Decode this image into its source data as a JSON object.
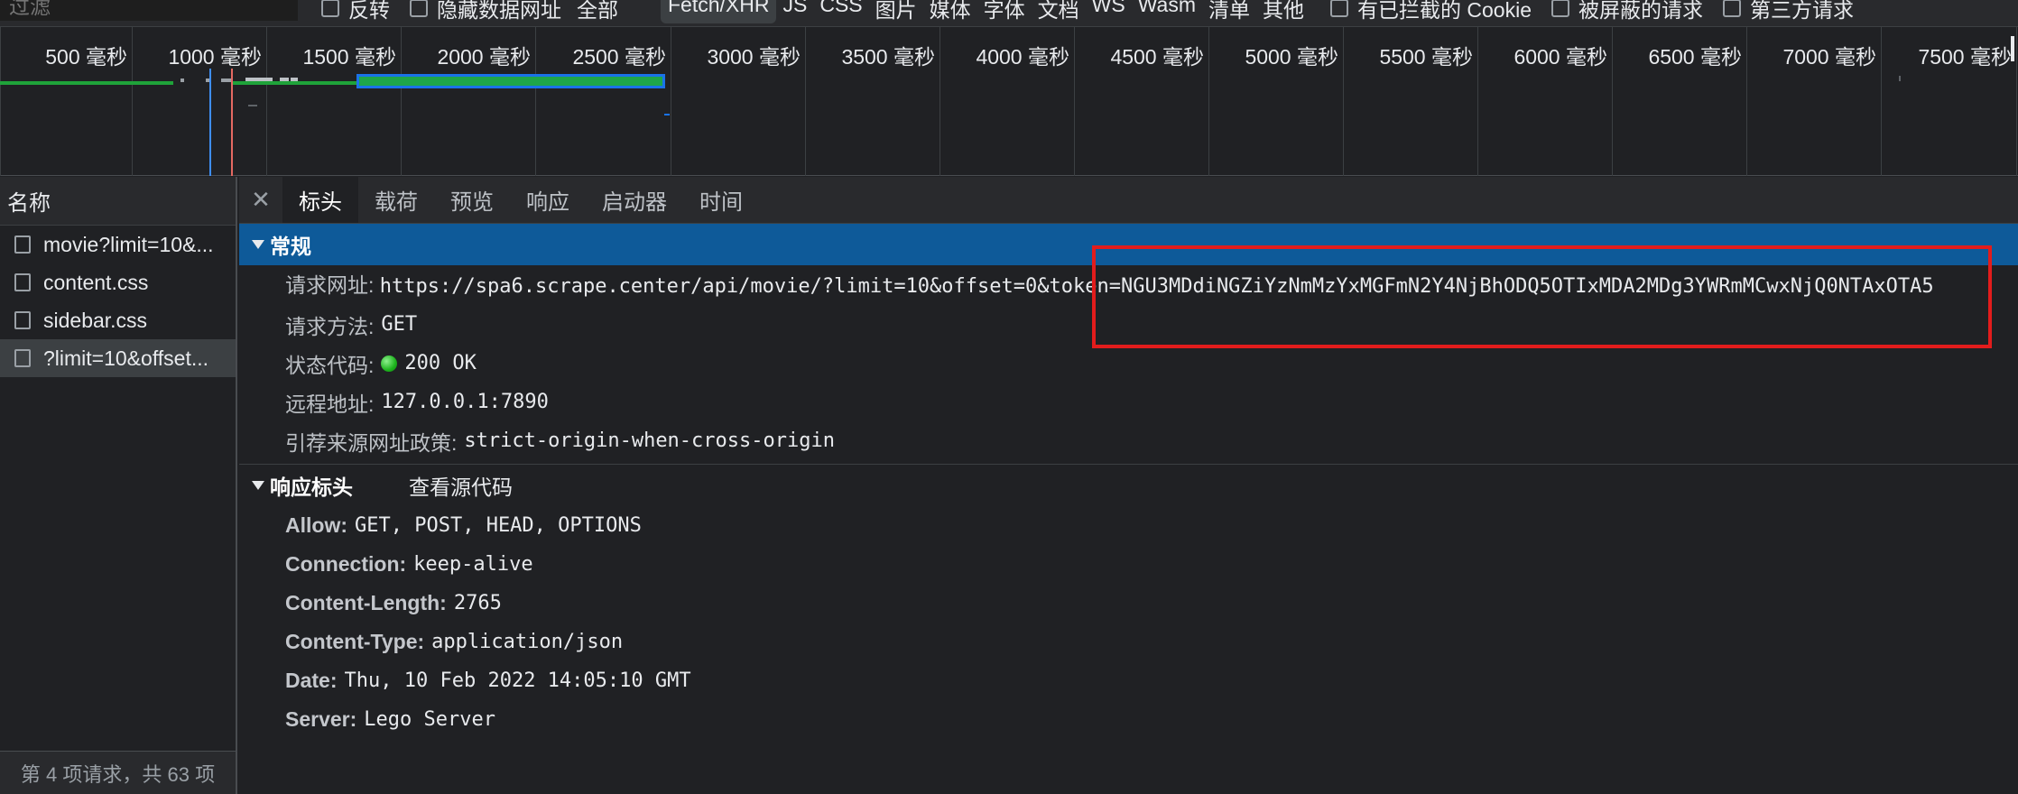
{
  "filter": {
    "placeholder": "过滤",
    "invert_label": "反转",
    "hide_data_urls_label": "隐藏数据网址",
    "types": [
      "全部",
      "Fetch/XHR",
      "JS",
      "CSS",
      "图片",
      "媒体",
      "字体",
      "文档",
      "WS",
      "Wasm",
      "清单",
      "其他"
    ],
    "active_type": "Fetch/XHR",
    "blocked_cookies_label": "有已拦截的 Cookie",
    "blocked_requests_label": "被屏蔽的请求",
    "third_party_label": "第三方请求"
  },
  "timeline": {
    "ticks": [
      "500 毫秒",
      "1000 毫秒",
      "1500 毫秒",
      "2000 毫秒",
      "2500 毫秒",
      "3000 毫秒",
      "3500 毫秒",
      "4000 毫秒",
      "4500 毫秒",
      "5000 毫秒",
      "5500 毫秒",
      "6000 毫秒",
      "6500 毫秒",
      "7000 毫秒",
      "7500 毫秒"
    ]
  },
  "list": {
    "header": "名称",
    "requests": [
      {
        "name": "movie?limit=10&..."
      },
      {
        "name": "content.css"
      },
      {
        "name": "sidebar.css"
      },
      {
        "name": "?limit=10&offset..."
      }
    ],
    "selected_index": 3,
    "status": "第 4 项请求，共 63 项"
  },
  "detail": {
    "tabs": [
      "标头",
      "载荷",
      "预览",
      "响应",
      "启动器",
      "时间"
    ],
    "active_tab": "标头",
    "general": {
      "title": "常规",
      "request_url_label": "请求网址:",
      "request_url": "https://spa6.scrape.center/api/movie/?limit=10&offset=0&token=NGU3MDdiNGZiYzNmMzYxMGFmN2Y4NjBhODQ5OTIxMDA2MDg3YWRmMCwxNjQ0NTAxOTA5",
      "method_label": "请求方法:",
      "method": "GET",
      "status_label": "状态代码:",
      "status": "200 OK",
      "remote_label": "远程地址:",
      "remote": "127.0.0.1:7890",
      "referrer_label": "引荐来源网址政策:",
      "referrer": "strict-origin-when-cross-origin"
    },
    "response_headers": {
      "title": "响应标头",
      "view_source": "查看源代码",
      "items": [
        {
          "key": "Allow:",
          "value": "GET, POST, HEAD, OPTIONS"
        },
        {
          "key": "Connection:",
          "value": "keep-alive"
        },
        {
          "key": "Content-Length:",
          "value": "2765"
        },
        {
          "key": "Content-Type:",
          "value": "application/json"
        },
        {
          "key": "Date:",
          "value": "Thu, 10 Feb 2022 14:05:10 GMT"
        },
        {
          "key": "Server:",
          "value": "Lego Server"
        }
      ]
    }
  },
  "colors": {
    "accent_blue": "#0e5a99",
    "highlight_red": "#e21c1c",
    "status_green": "#1db31d"
  }
}
